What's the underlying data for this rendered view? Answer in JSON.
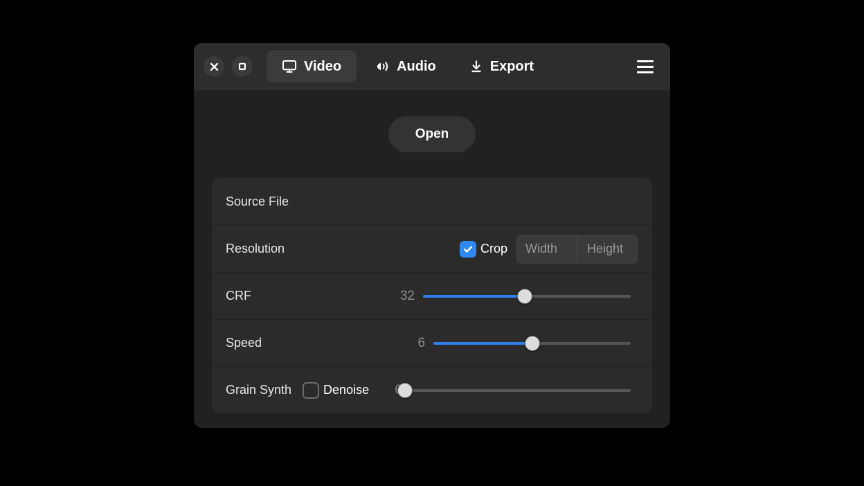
{
  "window": {
    "controls": [
      {
        "name": "close",
        "icon": "close-icon",
        "label": "Close"
      },
      {
        "name": "maximize",
        "icon": "maximize-icon",
        "label": "Maximize"
      }
    ],
    "menu_label": "Menu"
  },
  "tabs": [
    {
      "label": "Video",
      "icon": "monitor-icon",
      "active": true
    },
    {
      "label": "Audio",
      "icon": "speaker-icon",
      "active": false
    },
    {
      "label": "Export",
      "icon": "download-icon",
      "active": false
    }
  ],
  "actions": {
    "open_label": "Open"
  },
  "settings": {
    "source_file": {
      "label": "Source File",
      "value": ""
    },
    "resolution": {
      "label": "Resolution",
      "crop_label": "Crop",
      "crop_checked": true,
      "width_placeholder": "Width",
      "width_value": "",
      "height_placeholder": "Height",
      "height_value": ""
    },
    "crf": {
      "label": "CRF",
      "value": "32",
      "percent": 49
    },
    "speed": {
      "label": "Speed",
      "value": "6",
      "percent": 50
    },
    "grain": {
      "label": "Grain Synth",
      "denoise_label": "Denoise",
      "denoise_checked": false,
      "value": "0",
      "percent": 0
    }
  },
  "colors": {
    "accent": "#2f80ed",
    "checkbox_on": "#2f8af5",
    "window_bg": "#212121",
    "titlebar_bg": "#2d2d2d",
    "card_bg": "#2b2b2b",
    "desktop_bg": "#000000"
  }
}
